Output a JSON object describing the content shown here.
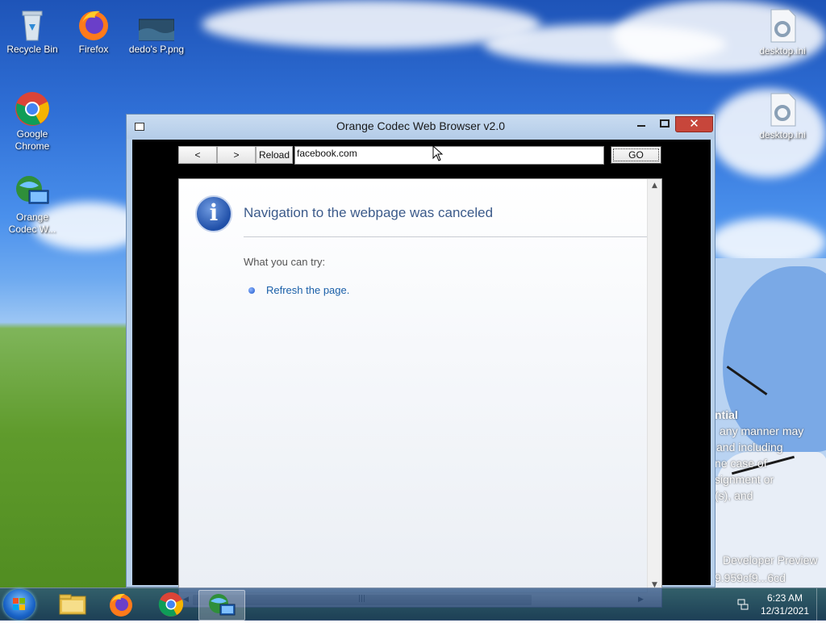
{
  "desktop": {
    "icons": [
      {
        "label": "Recycle Bin",
        "icon": "recycle-bin-icon"
      },
      {
        "label": "Firefox",
        "icon": "firefox-icon"
      },
      {
        "label": "dedo's P.png",
        "icon": "image-file-icon"
      },
      {
        "label": "Google Chrome",
        "icon": "chrome-icon"
      },
      {
        "label": "Orange Codec W...",
        "icon": "globe-computer-icon"
      },
      {
        "label": "desktop.ini",
        "icon": "settings-file-icon"
      },
      {
        "label": "desktop.ini",
        "icon": "settings-file-icon"
      }
    ],
    "wallpaper_overlay_text": [
      "ntial",
      "any manner may",
      "and including",
      "ne case of",
      "signment or",
      "(s), and",
      "Developer Preview",
      "9.959cf9...6cd"
    ]
  },
  "window": {
    "title": "Orange Codec Web Browser v2.0",
    "close_glyph": "✕",
    "toolbar": {
      "back_label": "<",
      "forward_label": ">",
      "reload_label": "Reload",
      "url_value": "facebook.com",
      "go_label": "GO"
    },
    "page": {
      "heading": "Navigation to the webpage was canceled",
      "try_label": "What you can try:",
      "suggestion": "Refresh the page.",
      "info_glyph": "i"
    }
  },
  "taskbar": {
    "items": [
      "start-orb",
      "file-explorer-icon",
      "firefox-icon",
      "chrome-icon",
      "orange-codec-browser-icon"
    ],
    "clock_time": "6:23 AM",
    "clock_date": "12/31/2021"
  },
  "colors": {
    "title_bar": "#b8d0ea",
    "close_button": "#c7463b",
    "heading_text": "#3b5a8a",
    "link_text": "#1a5fa8"
  }
}
